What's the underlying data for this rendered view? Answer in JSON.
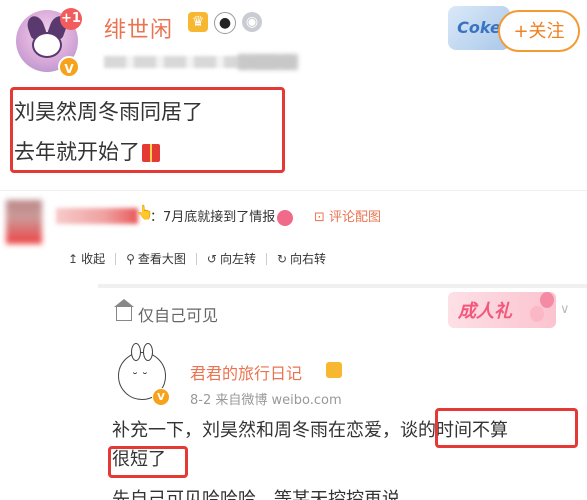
{
  "post": {
    "username": "绯世闲",
    "notification_count": "+1",
    "verified_mark": "V",
    "follow_label": "+关注",
    "brand_sticker": "Coke",
    "text_line1": "刘昊然周冬雨同居了",
    "text_line2": "去年就开始了"
  },
  "comment": {
    "text": "：7月底就接到了情报",
    "link_label": "评论配图"
  },
  "viewer_toolbar": {
    "collapse_label": "收起",
    "large_label": "查看大图",
    "rotate_left_label": "向左转",
    "rotate_right_label": "向右转"
  },
  "screenshot": {
    "privacy_label": "仅自己可见",
    "banner_text": "成人礼",
    "author": "君君的旅行日记",
    "meta": "8-2 来自微博 weibo.com",
    "body_line1": "补充一下，刘昊然和周冬雨在恋爱，谈的时间不算",
    "body_line2": "很短了",
    "body_line3": "先自己可见哈哈哈，等某天控控再说"
  },
  "colors": {
    "accent": "#eb7350",
    "highlight_box": "#e53935",
    "follow_border": "#f39a33"
  }
}
